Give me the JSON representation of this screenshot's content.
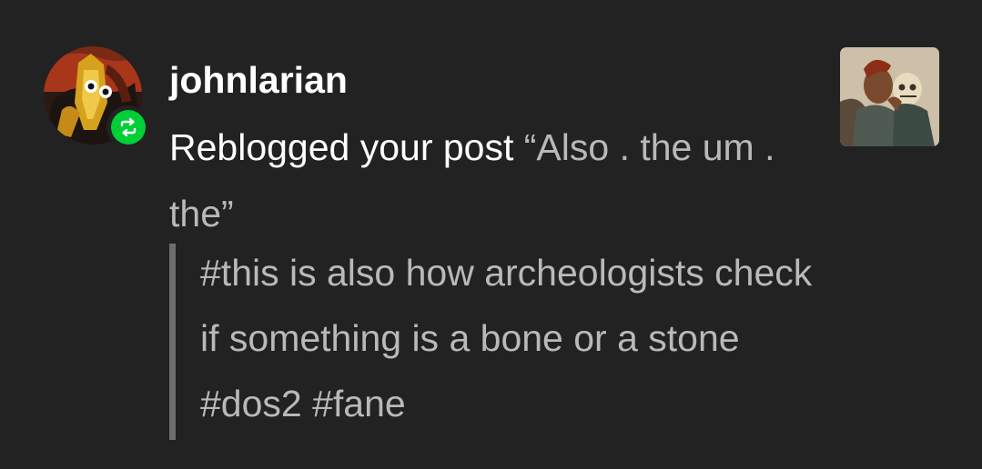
{
  "notification": {
    "username": "johnlarian",
    "action_text": "Reblogged your post",
    "post_title": "“Also . the um . the”",
    "tags": "#this is also how archeologists check if something is a bone or a stone #dos2 #fane"
  },
  "icons": {
    "avatar": "user-avatar",
    "badge": "reblog-icon",
    "thumbnail": "post-thumbnail"
  },
  "colors": {
    "background": "#222222",
    "reblog_green": "#00cf35",
    "muted_text": "#b9b9b9",
    "quote_bar": "#6e6e6e"
  }
}
